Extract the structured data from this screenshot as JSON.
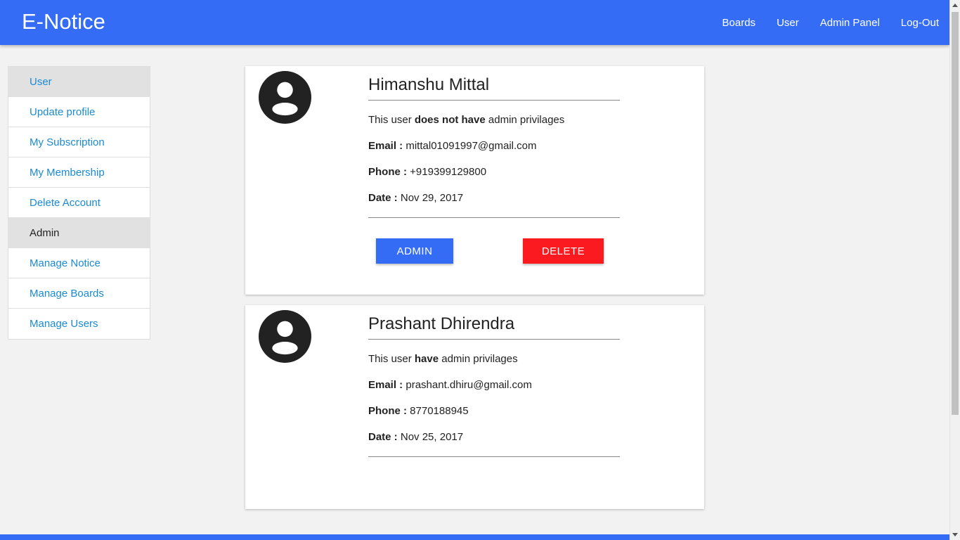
{
  "header": {
    "brand": "E-Notice",
    "nav": [
      "Boards",
      "User",
      "Admin Panel",
      "Log-Out"
    ]
  },
  "sidebar": {
    "items": [
      {
        "label": "User",
        "type": "header"
      },
      {
        "label": "Update profile",
        "type": "link"
      },
      {
        "label": "My Subscription",
        "type": "link"
      },
      {
        "label": "My Membership",
        "type": "link"
      },
      {
        "label": "Delete Account",
        "type": "link"
      },
      {
        "label": "Admin",
        "type": "header"
      },
      {
        "label": "Manage Notice",
        "type": "link"
      },
      {
        "label": "Manage Boards",
        "type": "link"
      },
      {
        "label": "Manage Users",
        "type": "link"
      }
    ]
  },
  "users": [
    {
      "name": "Himanshu Mittal",
      "status_prefix": "This user",
      "status_bold": "does not have",
      "status_suffix": "admin privilages",
      "email_label": "Email :",
      "email": "mittal01091997@gmail.com",
      "phone_label": "Phone :",
      "phone": "+919399129800",
      "date_label": "Date :",
      "date": "Nov 29, 2017",
      "admin_button": "ADMIN",
      "delete_button": "DELETE"
    },
    {
      "name": "Prashant Dhirendra",
      "status_prefix": "This user",
      "status_bold": "have",
      "status_suffix": "admin privilages",
      "email_label": "Email :",
      "email": "prashant.dhiru@gmail.com",
      "phone_label": "Phone :",
      "phone": "8770188945",
      "date_label": "Date :",
      "date": "Nov 25, 2017"
    }
  ],
  "colors": {
    "primary": "#356cf6",
    "danger": "#fb1a1f",
    "link": "#1a8ad4"
  }
}
